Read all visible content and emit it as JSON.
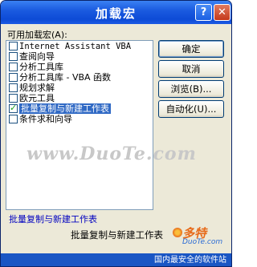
{
  "window": {
    "title": "加载宏",
    "help_glyph": "?",
    "close_glyph": "✕"
  },
  "list": {
    "label": "可用加载宏(A):",
    "items": [
      {
        "label": "Internet Assistant VBA",
        "checked": false,
        "selected": false
      },
      {
        "label": "查阅向导",
        "checked": false,
        "selected": false
      },
      {
        "label": "分析工具库",
        "checked": false,
        "selected": false
      },
      {
        "label": "分析工具库 - VBA 函数",
        "checked": false,
        "selected": false
      },
      {
        "label": "规划求解",
        "checked": false,
        "selected": false
      },
      {
        "label": "欧元工具",
        "checked": false,
        "selected": false
      },
      {
        "label": "批量复制与新建工作表",
        "checked": true,
        "selected": true
      },
      {
        "label": "条件求和向导",
        "checked": false,
        "selected": false
      }
    ]
  },
  "buttons": {
    "ok": "确定",
    "cancel": "取消",
    "browse": "浏览(B)...",
    "automation": "自动化(U)..."
  },
  "watermark": "www.DuoTe.com",
  "description": {
    "name": "批量复制与新建工作表",
    "text": "批量复制与新建工作表"
  },
  "logo": {
    "brand": "多特",
    "sub": "DuoTe.com"
  },
  "footer": "国内最安全的软件站"
}
